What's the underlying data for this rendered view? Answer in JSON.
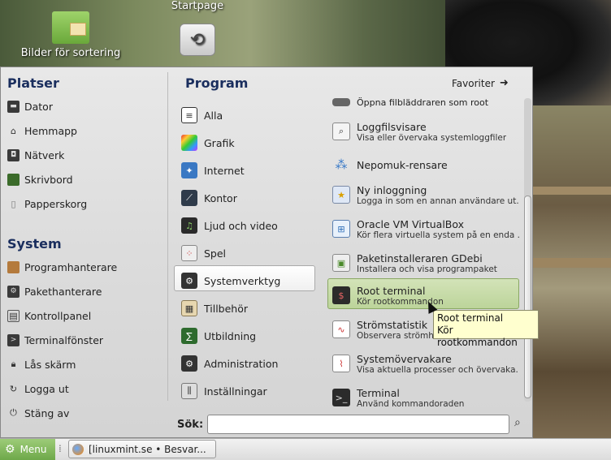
{
  "desktop": {
    "icons": [
      {
        "label": "Bilder för sortering"
      },
      {
        "label": "Startpage"
      }
    ]
  },
  "places": {
    "title": "Platser",
    "items": [
      {
        "label": "Dator",
        "icon": "computer-icon"
      },
      {
        "label": "Hemmapp",
        "icon": "home-icon"
      },
      {
        "label": "Nätverk",
        "icon": "network-icon"
      },
      {
        "label": "Skrivbord",
        "icon": "desktop-icon"
      },
      {
        "label": "Papperskorg",
        "icon": "trash-icon"
      }
    ]
  },
  "system": {
    "title": "System",
    "items": [
      {
        "label": "Programhanterare",
        "icon": "software-manager-icon"
      },
      {
        "label": "Pakethanterare",
        "icon": "package-manager-icon"
      },
      {
        "label": "Kontrollpanel",
        "icon": "control-panel-icon"
      },
      {
        "label": "Terminalfönster",
        "icon": "terminal-icon"
      },
      {
        "label": "Lås skärm",
        "icon": "lock-icon"
      },
      {
        "label": "Logga ut",
        "icon": "logout-icon"
      },
      {
        "label": "Stäng av",
        "icon": "power-icon"
      }
    ]
  },
  "programs": {
    "title": "Program",
    "favorites_label": "Favoriter",
    "categories": [
      {
        "label": "Alla"
      },
      {
        "label": "Grafik"
      },
      {
        "label": "Internet"
      },
      {
        "label": "Kontor"
      },
      {
        "label": "Ljud och video"
      },
      {
        "label": "Spel"
      },
      {
        "label": "Systemverktyg"
      },
      {
        "label": "Tillbehör"
      },
      {
        "label": "Utbildning"
      },
      {
        "label": "Administration"
      },
      {
        "label": "Inställningar"
      }
    ],
    "selected_category": "Systemverktyg"
  },
  "apps": [
    {
      "name": "Öppna filbläddraren som root",
      "desc": ""
    },
    {
      "name": "Loggfilsvisare",
      "desc": "Visa eller övervaka systemloggfiler"
    },
    {
      "name": "Nepomuk-rensare",
      "desc": ""
    },
    {
      "name": "Ny inloggning",
      "desc": "Logga in som en annan användare ut..."
    },
    {
      "name": "Oracle VM VirtualBox",
      "desc": "Kör flera virtuella system på en enda ..."
    },
    {
      "name": "Paketinstalleraren GDebi",
      "desc": "Installera och visa programpaket"
    },
    {
      "name": "Root terminal",
      "desc": "Kör rootkommandon"
    },
    {
      "name": "Strömstatistik",
      "desc": "Observera strömha"
    },
    {
      "name": "Systemövervakare",
      "desc": "Visa aktuella processer och övervaka..."
    },
    {
      "name": "Terminal",
      "desc": "Använd kommandoraden"
    }
  ],
  "tooltip": {
    "line1": "Root terminal",
    "line2": "Kör rootkommandon"
  },
  "search": {
    "label": "Sök:",
    "value": ""
  },
  "taskbar": {
    "menu_label": "Menu",
    "task_label": "[linuxmint.se • Besvar..."
  }
}
